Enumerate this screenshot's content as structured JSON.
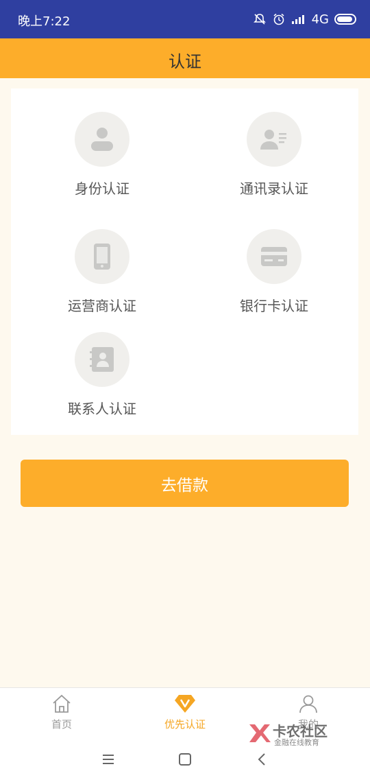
{
  "status_bar": {
    "time": "晚上7:22",
    "network": "4G",
    "color": "#2F3FA0"
  },
  "header": {
    "title": "认证",
    "color": "#FDAD2A"
  },
  "auth_items": [
    {
      "label": "身份认证",
      "icon": "person-icon"
    },
    {
      "label": "通讯录认证",
      "icon": "contact-card-icon"
    },
    {
      "label": "运营商认证",
      "icon": "phone-icon"
    },
    {
      "label": "银行卡认证",
      "icon": "bank-card-icon"
    },
    {
      "label": "联系人认证",
      "icon": "address-book-icon"
    }
  ],
  "borrow_button": {
    "label": "去借款"
  },
  "bottom_nav": {
    "items": [
      {
        "label": "首页",
        "icon": "home-icon",
        "active": false
      },
      {
        "label": "优先认证",
        "icon": "diamond-v-icon",
        "active": true
      },
      {
        "label": "我的",
        "icon": "user-icon",
        "active": false
      }
    ],
    "active_color": "#F5A623"
  },
  "watermark": {
    "title": "卡农社区",
    "subtitle": "金融在线教育"
  }
}
